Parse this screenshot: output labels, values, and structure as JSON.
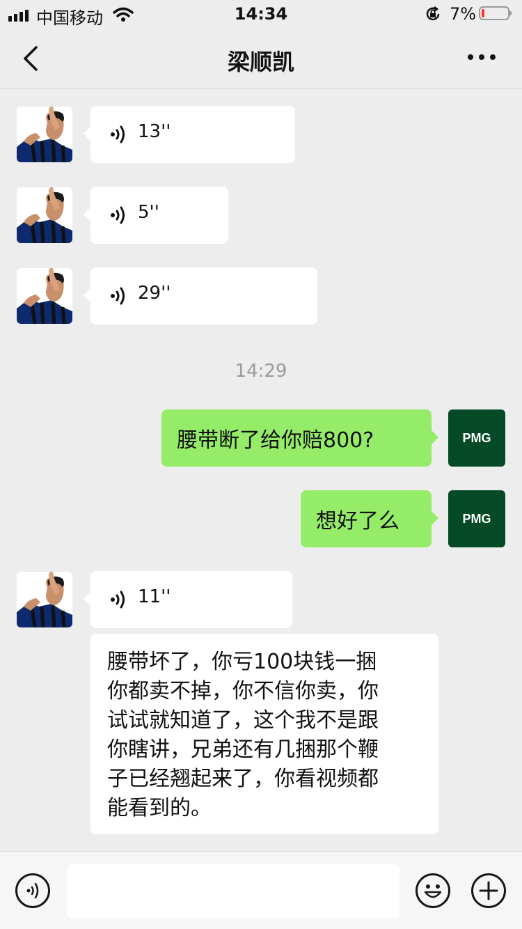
{
  "status_bar": {
    "carrier": "中国移动",
    "time": "14:34",
    "battery_percent": "7%",
    "battery_level": 0.07,
    "icons": [
      "signal-icon",
      "wifi-icon",
      "rotation-lock-icon",
      "battery-icon"
    ]
  },
  "nav": {
    "title": "梁顺凯",
    "back_icon": "chevron-left-icon",
    "more_icon": "more-dots-icon"
  },
  "messages": [
    {
      "side": "left",
      "type": "voice",
      "duration": "13''"
    },
    {
      "side": "left",
      "type": "voice",
      "duration": "5''"
    },
    {
      "side": "left",
      "type": "voice",
      "duration": "29''"
    },
    {
      "type": "timestamp",
      "text": "14:29"
    },
    {
      "side": "right",
      "type": "text",
      "text": "腰带断了给你赔800?"
    },
    {
      "side": "right",
      "type": "text",
      "text": "想好了么"
    },
    {
      "side": "left",
      "type": "voice",
      "duration": "11''"
    },
    {
      "side": "left",
      "type": "text",
      "lines": [
        "腰带坏了，你亏100块钱一捆",
        "你都卖不掉，你不信你卖，你",
        "试试就知道了，这个我不是跟",
        "你瞎讲，兄弟还有几捆那个鞭",
        "子已经翘起来了，你看视频都",
        "能看到的。"
      ]
    }
  ],
  "my_avatar_text": "PMG",
  "colors": {
    "background": "#ededed",
    "outgoing_bubble": "#95ec69",
    "incoming_bubble": "#ffffff",
    "my_avatar_bg": "#044a26",
    "battery_low": "#ff3333"
  },
  "input_bar": {
    "left_icon": "voice-input-icon",
    "right_icons": [
      "emoji-icon",
      "plus-icon"
    ]
  }
}
